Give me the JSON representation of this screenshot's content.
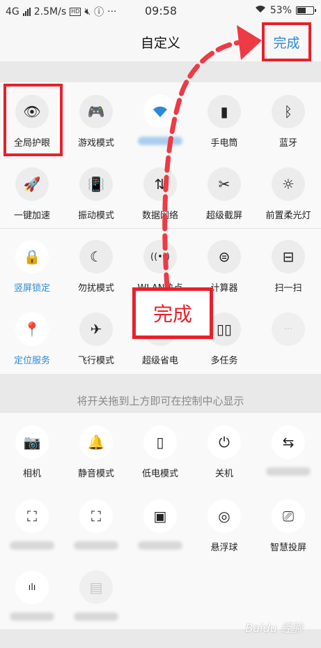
{
  "status_bar": {
    "network": "4G",
    "speed": "2.5M/s",
    "hd": "HD",
    "time": "09:58",
    "more": "···",
    "battery_percent": "53%",
    "battery_level": 0.53
  },
  "header": {
    "title": "自定义",
    "done_label": "完成"
  },
  "active_tiles": [
    {
      "label": "全局护眼",
      "icon": "eye-icon",
      "glyph": "👁",
      "highlighted": true
    },
    {
      "label": "游戏模式",
      "icon": "gamepad-icon",
      "glyph": "🎮"
    },
    {
      "label": "",
      "icon": "wifi-icon",
      "glyph": "wifi",
      "active": true,
      "blurred": true
    },
    {
      "label": "手电筒",
      "icon": "flashlight-icon",
      "glyph": "▮"
    },
    {
      "label": "蓝牙",
      "icon": "bluetooth-icon",
      "glyph": "ᛒ"
    },
    {
      "label": "一键加速",
      "icon": "rocket-icon",
      "glyph": "🚀"
    },
    {
      "label": "振动模式",
      "icon": "vibrate-icon",
      "glyph": "📳"
    },
    {
      "label": "数据网络",
      "icon": "data-network-icon",
      "glyph": "⇅"
    },
    {
      "label": "超级截屏",
      "icon": "screenshot-icon",
      "glyph": "✂"
    },
    {
      "label": "前置柔光灯",
      "icon": "soft-light-icon",
      "glyph": "☼"
    },
    {
      "label": "竖屏锁定",
      "icon": "rotation-lock-icon",
      "glyph": "🔒",
      "active": true
    },
    {
      "label": "勿扰模式",
      "icon": "moon-icon",
      "glyph": "☾"
    },
    {
      "label": "WLAN热点",
      "icon": "hotspot-icon",
      "glyph": "((•))"
    },
    {
      "label": "计算器",
      "icon": "calculator-icon",
      "glyph": "⊜"
    },
    {
      "label": "扫一扫",
      "icon": "scan-icon",
      "glyph": "⊟"
    },
    {
      "label": "定位服务",
      "icon": "location-icon",
      "glyph": "📍",
      "active": true
    },
    {
      "label": "飞行模式",
      "icon": "airplane-icon",
      "glyph": "✈"
    },
    {
      "label": "超级省电",
      "icon": "power-saving-icon",
      "glyph": "🔋"
    },
    {
      "label": "多任务",
      "icon": "multitask-icon",
      "glyph": "▯▯"
    },
    {
      "label": "",
      "icon": "more-icon",
      "glyph": "···",
      "faded": true
    }
  ],
  "hint": "将开关拖到上方即可在控制中心显示",
  "inactive_tiles": [
    {
      "label": "相机",
      "icon": "camera-icon",
      "glyph": "📷"
    },
    {
      "label": "静音模式",
      "icon": "bell-icon",
      "glyph": "🔔"
    },
    {
      "label": "低电模式",
      "icon": "low-battery-icon",
      "glyph": "▯"
    },
    {
      "label": "关机",
      "icon": "power-icon",
      "glyph": "⏻"
    },
    {
      "label": "",
      "icon": "switch-icon",
      "glyph": "⇆",
      "blurred": true
    },
    {
      "label": "",
      "icon": "face-scan-icon",
      "glyph": "⛶",
      "blurred": true
    },
    {
      "label": "",
      "icon": "crop-scan-icon",
      "glyph": "⛶",
      "blurred": true
    },
    {
      "label": "",
      "icon": "nfc-icon",
      "glyph": "▣",
      "blurred": true
    },
    {
      "label": "悬浮球",
      "icon": "floating-ball-icon",
      "glyph": "◎"
    },
    {
      "label": "智慧投屏",
      "icon": "cast-icon",
      "glyph": "⎚"
    },
    {
      "label": "",
      "icon": "voice-icon",
      "glyph": "ılı",
      "blurred": true
    },
    {
      "label": "",
      "icon": "sd-card-icon",
      "glyph": "▤",
      "blurred": true,
      "faded": true
    }
  ],
  "callout": {
    "text": "完成"
  },
  "watermark": "Baidu 经验"
}
